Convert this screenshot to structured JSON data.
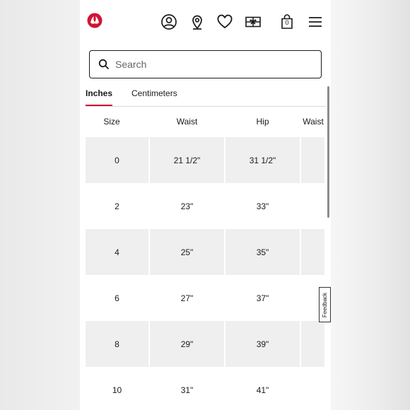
{
  "header": {
    "logo": "lululemon-logo",
    "icons": [
      "account-icon",
      "store-locator-icon",
      "wishlist-heart-icon",
      "gift-card-icon",
      "shopping-bag-icon",
      "hamburger-menu-icon"
    ],
    "cart_count": "0",
    "brand_color": "#d31334"
  },
  "search": {
    "placeholder": "Search",
    "value": ""
  },
  "tabs": [
    {
      "label": "Inches",
      "active": true
    },
    {
      "label": "Centimeters",
      "active": false
    }
  ],
  "table": {
    "columns": [
      "Size",
      "Waist",
      "Hip",
      "Waist"
    ],
    "rows": [
      [
        "0",
        "21 1/2\"",
        "31 1/2\"",
        ""
      ],
      [
        "2",
        "23\"",
        "33\"",
        ""
      ],
      [
        "4",
        "25\"",
        "35\"",
        ""
      ],
      [
        "6",
        "27\"",
        "37\"",
        ""
      ],
      [
        "8",
        "29\"",
        "39\"",
        ""
      ],
      [
        "10",
        "31\"",
        "41\"",
        ""
      ]
    ]
  },
  "feedback": {
    "label": "Feedback"
  }
}
